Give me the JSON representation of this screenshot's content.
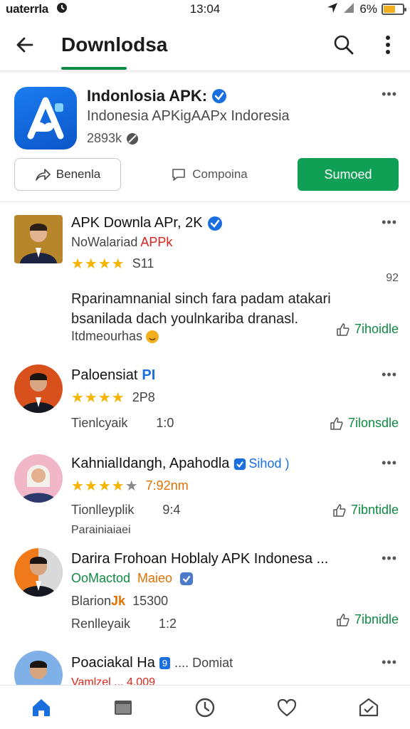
{
  "status": {
    "carrier": "uaterrla",
    "time": "13:04",
    "battery": "6%",
    "battery_level": 0.6
  },
  "appbar": {
    "title": "Downlodsa"
  },
  "app": {
    "name": "Indonlosia APK:",
    "subtitle": "Indonesia APKigAAPx Indoresia",
    "count": "2893k",
    "btn_outline": "Benenla",
    "btn_plain": "Compoina",
    "btn_primary": "Sumoed",
    "colors": {
      "brand": "#1a7cf0",
      "accent": "#10a055"
    }
  },
  "reviews": [
    {
      "name": "APK Downla APr, 2K",
      "line1_prefix": "NoWalariad",
      "line1_tag": "APPk",
      "stars": "★★★★",
      "rating_text": "S11",
      "side_num": "92",
      "body": "Rparinamnanial sinch fara padam atakari bsanilada dach youlnkariba dranasl.",
      "meta": "Itdmeourhas",
      "like": "7ihoidle"
    },
    {
      "name": "Paloensiat",
      "name_tag": "PI",
      "stars": "★★★★",
      "rating_text": "2P8",
      "meta": "Tienlcyaik",
      "meta_num": "1:0",
      "like": "7ilonsdle"
    },
    {
      "name": "KahnialIdangh, Apahodla",
      "name_tag": "Sihod )",
      "stars": "★★★★",
      "star_empty": "★",
      "rating_text": "7:92nm",
      "meta": "Tionlleyplik",
      "meta_num": "9:4",
      "sub_meta": "Parainiaiaei",
      "like": "7ibntidle"
    },
    {
      "name": "Darira Frohoan Hoblaly APK Indonesa ...",
      "line1_prefix": "OoMactod",
      "line1_tag": "Maieo",
      "line2_prefix": "Blarion",
      "line2_tag": "Jk",
      "line2_num": "15300",
      "meta": "Renlleyaik",
      "meta_num": "1:2",
      "like": "7ibnidle"
    },
    {
      "name": "Poaciakal Ha",
      "name_tag": "9",
      "name_suffix": "....  Domiat",
      "partial": "Vamlzel ... 4.009"
    }
  ],
  "more_label": "•••"
}
